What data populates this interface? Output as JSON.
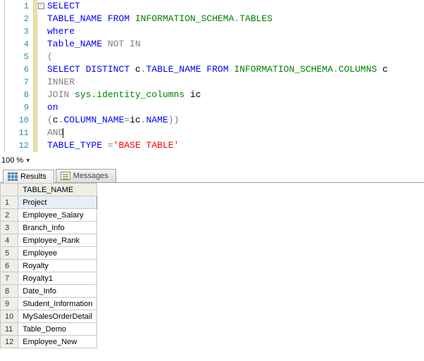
{
  "code": {
    "line1_select": "SELECT",
    "line2_tablename": "TABLE_NAME",
    "line2_from": "FROM",
    "line2_schema": "INFORMATION_SCHEMA",
    "line2_dot": ".",
    "line2_tables": "TABLES",
    "line3_where": "where",
    "line4_tbl": "Table_NAME",
    "line4_notin": "NOT IN",
    "line5_paren": "(",
    "line6_select": "SELECT",
    "line6_distinct": "DISTINCT",
    "line6_c": " c",
    "line6_dot": ".",
    "line6_tname": "TABLE_NAME",
    "line6_from": "FROM",
    "line6_schema": "INFORMATION_SCHEMA",
    "line6_cols": "COLUMNS",
    "line6_alias": " c",
    "line7_inner": "INNER",
    "line8_join": "JOIN",
    "line8_sys": "sys.identity_columns",
    "line8_ic": " ic",
    "line9_on": "on",
    "line10_open": "(",
    "line10_c": "c",
    "line10_dot1": ".",
    "line10_col": "COLUMN_NAME",
    "line10_eq": "=",
    "line10_ic": "ic",
    "line10_dot2": ".",
    "line10_name": "NAME",
    "line10_close": "))",
    "line11_and": "AND",
    "line12_tt": "TABLE_TYPE",
    "line12_eq": " =",
    "line12_str": "'BASE TABLE'"
  },
  "line_numbers": [
    "1",
    "2",
    "3",
    "4",
    "5",
    "6",
    "7",
    "8",
    "9",
    "10",
    "11",
    "12"
  ],
  "zoom": {
    "value": "100 %"
  },
  "tabs": {
    "results": "Results",
    "messages": "Messages"
  },
  "grid": {
    "header": "TABLE_NAME",
    "rows": [
      {
        "n": "1",
        "v": "Project"
      },
      {
        "n": "2",
        "v": "Employee_Salary"
      },
      {
        "n": "3",
        "v": "Branch_Info"
      },
      {
        "n": "4",
        "v": "Employee_Rank"
      },
      {
        "n": "5",
        "v": "Employee"
      },
      {
        "n": "6",
        "v": "Royalty"
      },
      {
        "n": "7",
        "v": "Royalty1"
      },
      {
        "n": "8",
        "v": "Date_Info"
      },
      {
        "n": "9",
        "v": "Student_Information"
      },
      {
        "n": "10",
        "v": "MySalesOrderDetail"
      },
      {
        "n": "11",
        "v": "Table_Demo"
      },
      {
        "n": "12",
        "v": "Employee_New"
      }
    ]
  }
}
